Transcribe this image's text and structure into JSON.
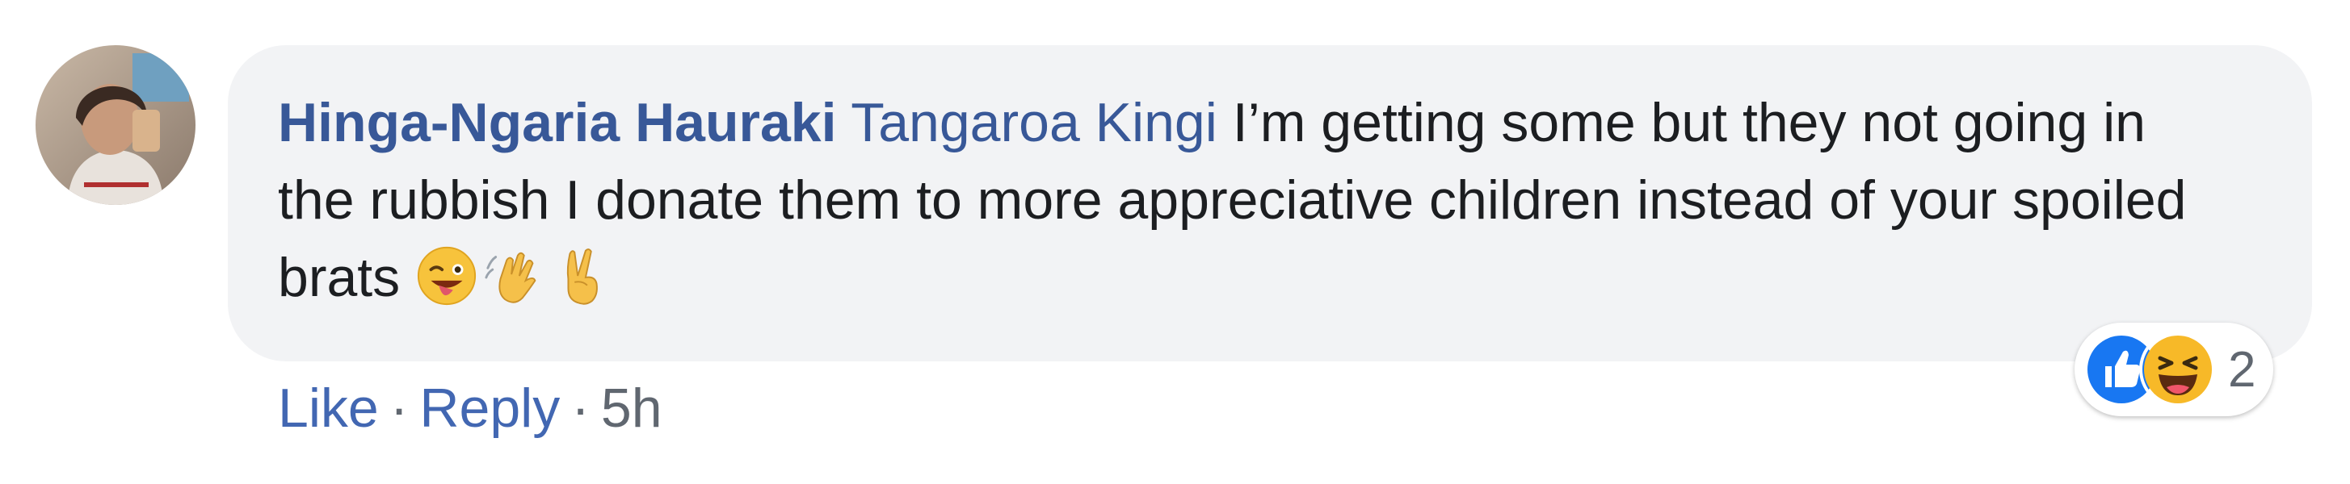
{
  "comment": {
    "author": "Hinga-Ngaria Hauraki",
    "mention": "Tangaroa Kingi",
    "text": "I’m getting some but they not going in the rubbish I donate them to more appreciative children instead of your spoiled brats",
    "emojis": [
      "winking-face-with-tongue-icon",
      "waving-hand-icon",
      "victory-hand-icon"
    ]
  },
  "reactions": {
    "icons": [
      "like-icon",
      "haha-icon"
    ],
    "count": "2"
  },
  "actions": {
    "like": "Like",
    "separator": "·",
    "reply": "Reply",
    "time": "5h"
  },
  "colors": {
    "link": "#385898",
    "bubble": "#f2f3f5",
    "like_blue": "#1877f2",
    "meta": "#606770"
  }
}
